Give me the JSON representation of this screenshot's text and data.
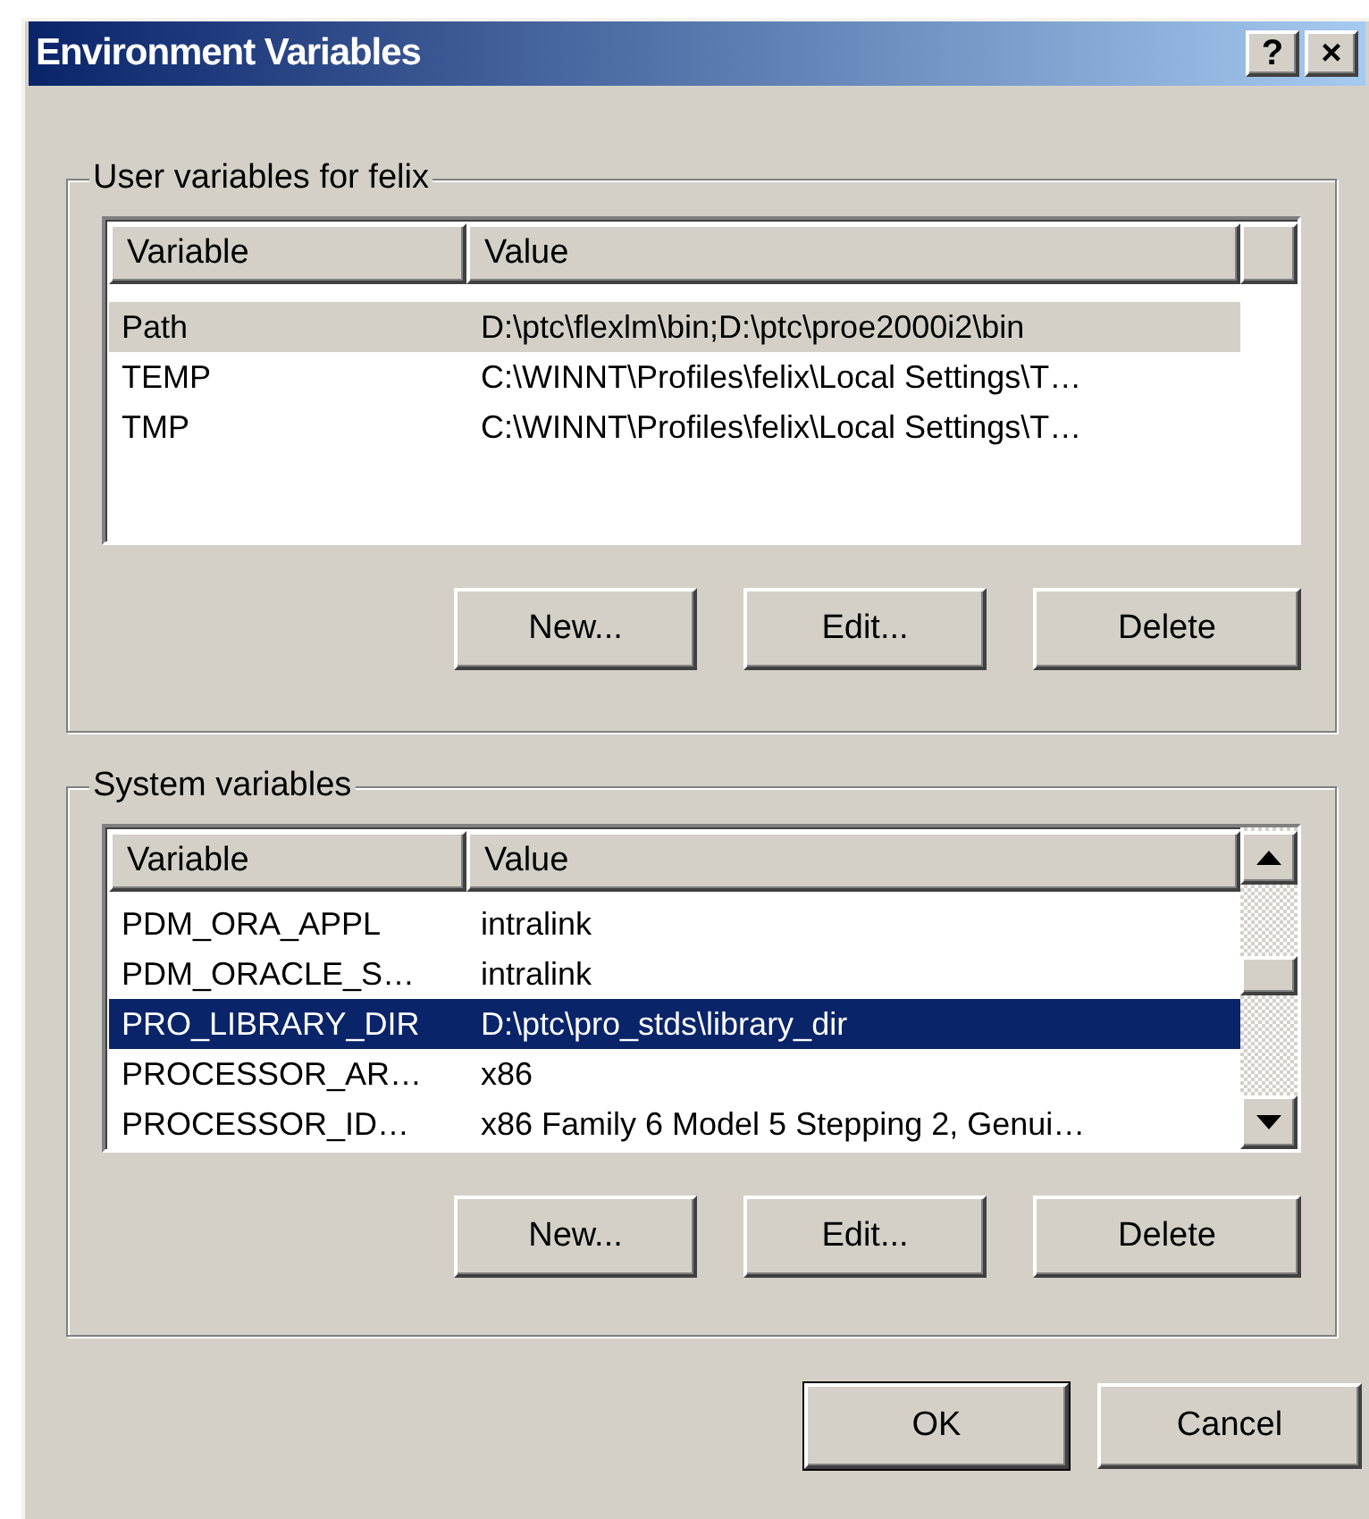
{
  "window": {
    "title": "Environment Variables",
    "title_buttons": [
      "?",
      "×"
    ]
  },
  "groups": [
    {
      "label": "User variables for felix",
      "list": {
        "focused": false,
        "columns": [
          "Variable",
          "Value"
        ],
        "scrollbar": false,
        "rows": [
          {
            "variable": "Path",
            "value": "D:\\ptc\\flexlm\\bin;D:\\ptc\\proe2000i2\\bin",
            "selected": true
          },
          {
            "variable": "TEMP",
            "value": "C:\\WINNT\\Profiles\\felix\\Local Settings\\T…",
            "selected": false
          },
          {
            "variable": "TMP",
            "value": "C:\\WINNT\\Profiles\\felix\\Local Settings\\T…",
            "selected": false
          }
        ]
      },
      "buttons": [
        "New...",
        "Edit...",
        "Delete"
      ]
    },
    {
      "label": "System variables",
      "list": {
        "focused": true,
        "columns": [
          "Variable",
          "Value"
        ],
        "scrollbar": true,
        "rows": [
          {
            "variable": "PDM_ORA_APPL",
            "value": "intralink",
            "selected": false
          },
          {
            "variable": "PDM_ORACLE_S…",
            "value": "intralink",
            "selected": false
          },
          {
            "variable": "PRO_LIBRARY_DIR",
            "value": "D:\\ptc\\pro_stds\\library_dir",
            "selected": true
          },
          {
            "variable": "PROCESSOR_AR…",
            "value": "x86",
            "selected": false
          },
          {
            "variable": "PROCESSOR_ID…",
            "value": "x86 Family 6 Model 5 Stepping 2, Genui…",
            "selected": false
          }
        ]
      },
      "buttons": [
        "New...",
        "Edit...",
        "Delete"
      ]
    }
  ],
  "buttons": [
    "OK",
    "Cancel"
  ]
}
